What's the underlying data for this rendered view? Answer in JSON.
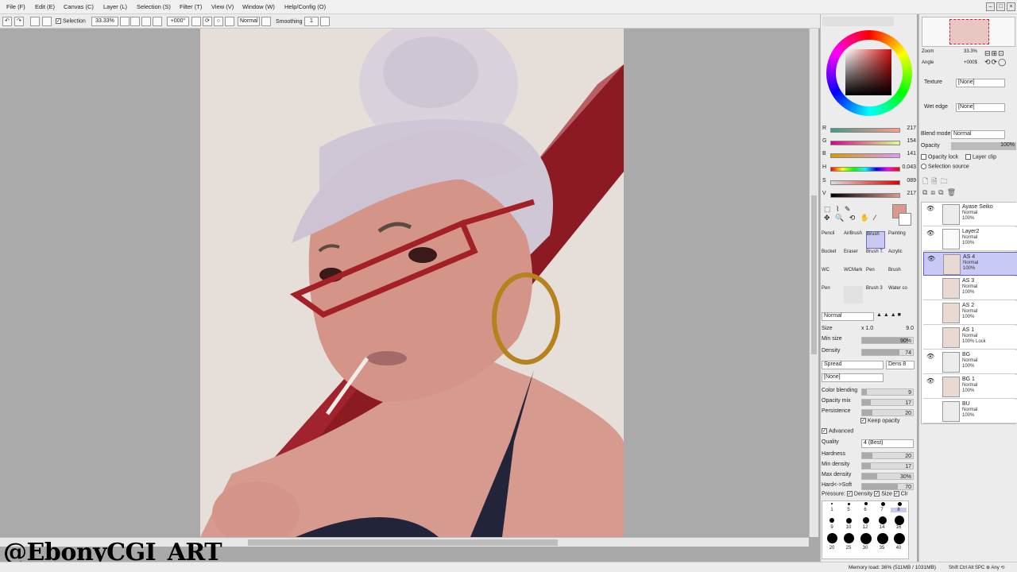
{
  "menu": [
    "File (F)",
    "Edit (E)",
    "Canvas (C)",
    "Layer (L)",
    "Selection (S)",
    "Filter (T)",
    "View (V)",
    "Window (W)",
    "Help/Config (O)"
  ],
  "toolbar": {
    "selection_label": "Selection",
    "zoom": "33.33%",
    "angle": "+000°",
    "mode": "Normal",
    "smoothing_label": "Smoothing",
    "smoothing_value": "1"
  },
  "navigator": {
    "zoom_label": "Zoom",
    "zoom_value": "33.3%",
    "angle_label": "Angle",
    "angle_value": "+000$"
  },
  "color": {
    "r_label": "R",
    "r": "217",
    "g_label": "G",
    "g": "154",
    "b_label": "B",
    "b": "141",
    "h_label": "H",
    "h": "0.043",
    "s_label": "S",
    "s": "089",
    "v_label": "V",
    "v": "217",
    "current": "#d9998d"
  },
  "tools": [
    "Pencil",
    "AirBrush",
    "Brush",
    "Painting",
    "Bucket",
    "Eraser",
    "Brush T.",
    "Acrylic",
    "WC",
    "WCMark",
    "Pen",
    "Brush",
    "Pen",
    "",
    "Brush 3",
    "Water co"
  ],
  "brush": {
    "blend": "Normal",
    "size_label": "Size",
    "size_mult": "x 1.0",
    "size": "9.0",
    "min_size_label": "Min size",
    "min_size": "90%",
    "density_label": "Density",
    "density": "74",
    "spread": "Spread",
    "dens_label": "Dens",
    "dens": "8",
    "texture": "[None]",
    "color_blending_label": "Color blending",
    "color_blending": "9",
    "opacity_mix_label": "Opacity mix",
    "opacity_mix": "17",
    "persistence_label": "Persistence",
    "persistence": "20",
    "keep_opacity": "Keep opacity",
    "advanced": "Advanced",
    "quality_label": "Quality",
    "quality": "4 (Best)",
    "hardness_label": "Hardness",
    "hardness": "20",
    "min_density_label": "Min density",
    "min_density": "17",
    "max_density_label": "Max density",
    "max_density": "30%",
    "hard_soft_label": "Hard<->Soft",
    "hard_soft": "70",
    "pressure_label": "Pressure:",
    "p_density": "Density",
    "p_size": "Size",
    "p_clr": "Clr"
  },
  "brush_sizes": [
    "1",
    "5",
    "6",
    "7",
    "8",
    "9",
    "10",
    "12",
    "14",
    "16",
    "20",
    "25",
    "30",
    "35",
    "40",
    "50"
  ],
  "layer_props": {
    "texture_label": "Texture",
    "texture": "[None]",
    "wet_edge_label": "Wet edge",
    "wet_edge": "[None]",
    "blend_label": "Blend mode",
    "blend": "Normal",
    "opacity_label": "Opacity",
    "opacity": "100%",
    "opacity_lock": "Opacity lock",
    "layer_clip": "Layer clip",
    "selection_source": "Selection source"
  },
  "layers": [
    {
      "name": "Ayase Seiko",
      "mode": "Normal",
      "opacity": "100%",
      "folder": true
    },
    {
      "name": "Layer2",
      "mode": "Normal",
      "opacity": "100%"
    },
    {
      "name": "AS 4",
      "mode": "Normal",
      "opacity": "100%",
      "selected": true
    },
    {
      "name": "AS 3",
      "mode": "Normal",
      "opacity": "100%"
    },
    {
      "name": "AS 2",
      "mode": "Normal",
      "opacity": "100%"
    },
    {
      "name": "AS 1",
      "mode": "Normal",
      "opacity": "100% Lock"
    },
    {
      "name": "BG",
      "mode": "Normal",
      "opacity": "100%",
      "folder": true
    },
    {
      "name": "BG 1",
      "mode": "Normal",
      "opacity": "100%"
    },
    {
      "name": "BU",
      "mode": "Normal",
      "opacity": "100%",
      "folder": true
    }
  ],
  "watermark": "@EbonyCGI_ART",
  "status": {
    "memory": "Memory load: 36% (511MB / 1031MB)",
    "keys": "Shift Ctrl Alt SPC ⊕ Any ⟲"
  }
}
